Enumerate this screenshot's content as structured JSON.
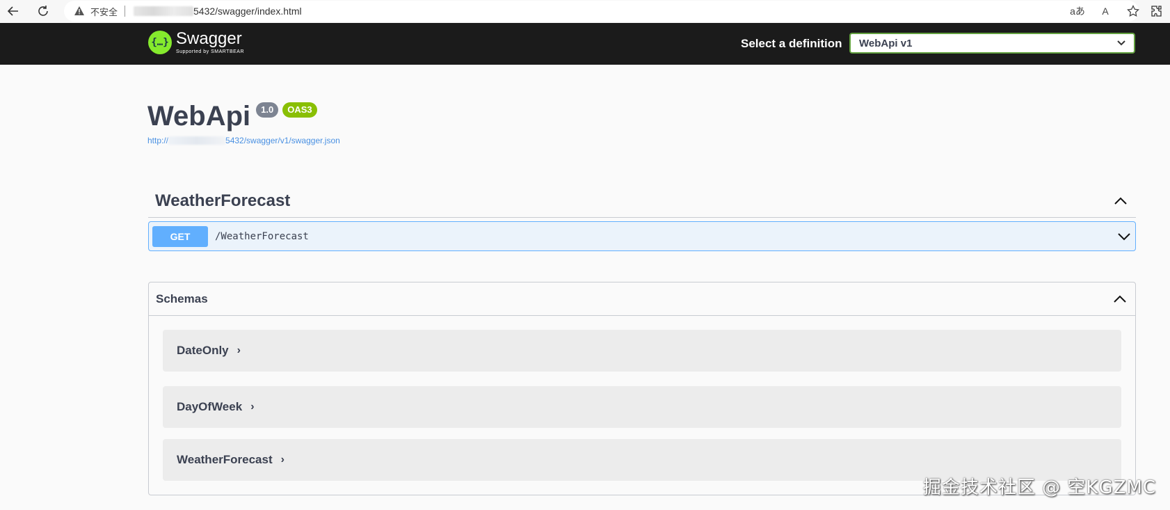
{
  "browser": {
    "security_label": "不安全",
    "url_tail": "5432/swagger/index.html",
    "read_aloud_label": "A",
    "translate_label": "aあ"
  },
  "topbar": {
    "brand": "Swagger",
    "brand_sub": "Supported by SMARTBEAR",
    "definition_label": "Select a definition",
    "definition_value": "WebApi v1"
  },
  "info": {
    "title": "WebApi",
    "version": "1.0",
    "oas": "OAS3",
    "link_prefix": "http://",
    "link_suffix": "5432/swagger/v1/swagger.json"
  },
  "tag": {
    "name": "WeatherForecast",
    "operations": [
      {
        "method": "GET",
        "path": "/WeatherForecast"
      }
    ]
  },
  "schemas": {
    "title": "Schemas",
    "models": [
      "DateOnly",
      "DayOfWeek",
      "WeatherForecast"
    ]
  },
  "watermark": "掘金技术社区 @ 空KGZMC",
  "colors": {
    "topbar": "#1b1b1b",
    "get": "#61affe",
    "oas_badge": "#89bf04",
    "version_badge": "#7d8492",
    "logo": "#85ea2d"
  }
}
